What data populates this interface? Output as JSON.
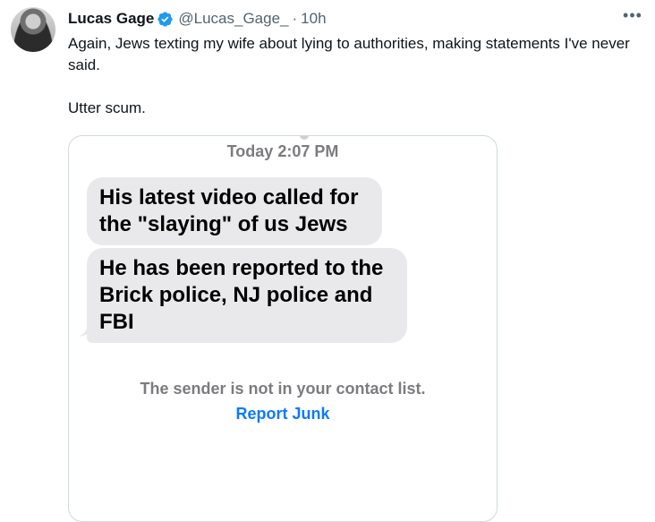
{
  "tweet": {
    "author_name": "Lucas Gage",
    "handle": "@Lucas_Gage_",
    "separator": "·",
    "time": "10h",
    "text": "Again, Jews texting my wife about lying to authorities, making statements I've never said.\n\nUtter scum.",
    "verified_icon": "verified-badge-icon",
    "more_icon": "more-options-icon"
  },
  "media": {
    "timestamp": "Today 2:07 PM",
    "messages": [
      "His latest video called for the \"slaying\" of us Jews",
      "He has been reported to the Brick police, NJ police and FBI"
    ],
    "sender_notice": "The sender is not in your contact list.",
    "report_link": "Report Junk"
  },
  "colors": {
    "verified_blue": "#1d9bf0",
    "secondary_text": "#536471",
    "imessage_link_blue": "#0a7aff",
    "bubble_gray": "#e9e9eb"
  }
}
